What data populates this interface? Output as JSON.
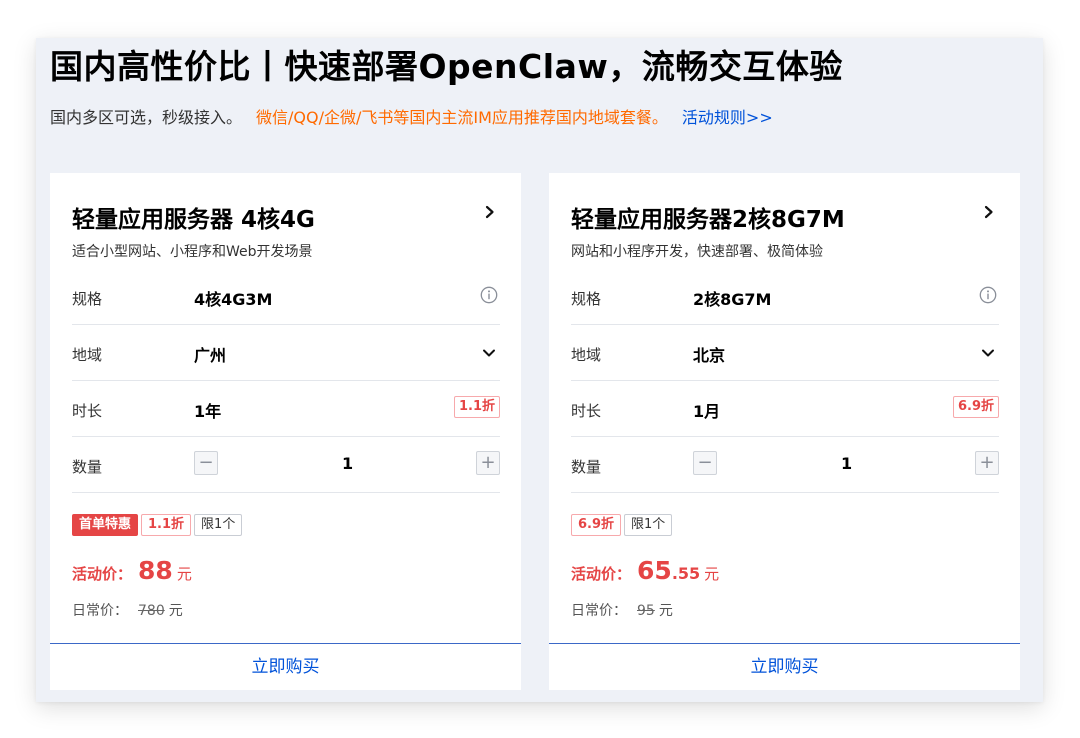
{
  "header": {
    "title": "国内高性价比丨快速部署OpenClaw，流畅交互体验",
    "subtitle_gray": "国内多区可选，秒级接入。",
    "subtitle_orange": "微信/QQ/企微/飞书等国内主流IM应用推荐国内地域套餐。",
    "rules_link": "活动规则>>"
  },
  "colors": {
    "accent_blue": "#0052d9",
    "price_red": "#e54545",
    "promo_orange": "#ff6a00"
  },
  "cards": [
    {
      "title": "轻量应用服务器 4核4G",
      "desc": "适合小型网站、小程序和Web开发场景",
      "spec_label": "规格",
      "spec_value": "4核4G3M",
      "region_label": "地域",
      "region_value": "广州",
      "duration_label": "时长",
      "duration_value": "1年",
      "duration_discount": "1.1折",
      "qty_label": "数量",
      "qty_value": "1",
      "tags": {
        "promo": "首单特惠",
        "discount": "1.1折",
        "limit": "限1个"
      },
      "price_label": "活动价：",
      "price_int": "88",
      "price_dec": "",
      "price_unit": "元",
      "orig_label": "日常价：",
      "orig_price": "780",
      "orig_unit": "元",
      "buy_label": "立即购买"
    },
    {
      "title": "轻量应用服务器2核8G7M",
      "desc": "网站和小程序开发，快速部署、极简体验",
      "spec_label": "规格",
      "spec_value": "2核8G7M",
      "region_label": "地域",
      "region_value": "北京",
      "duration_label": "时长",
      "duration_value": "1月",
      "duration_discount": "6.9折",
      "qty_label": "数量",
      "qty_value": "1",
      "tags": {
        "discount": "6.9折",
        "limit": "限1个"
      },
      "price_label": "活动价：",
      "price_int": "65",
      "price_dec": ".55",
      "price_unit": "元",
      "orig_label": "日常价：",
      "orig_price": "95",
      "orig_unit": "元",
      "buy_label": "立即购买"
    }
  ]
}
